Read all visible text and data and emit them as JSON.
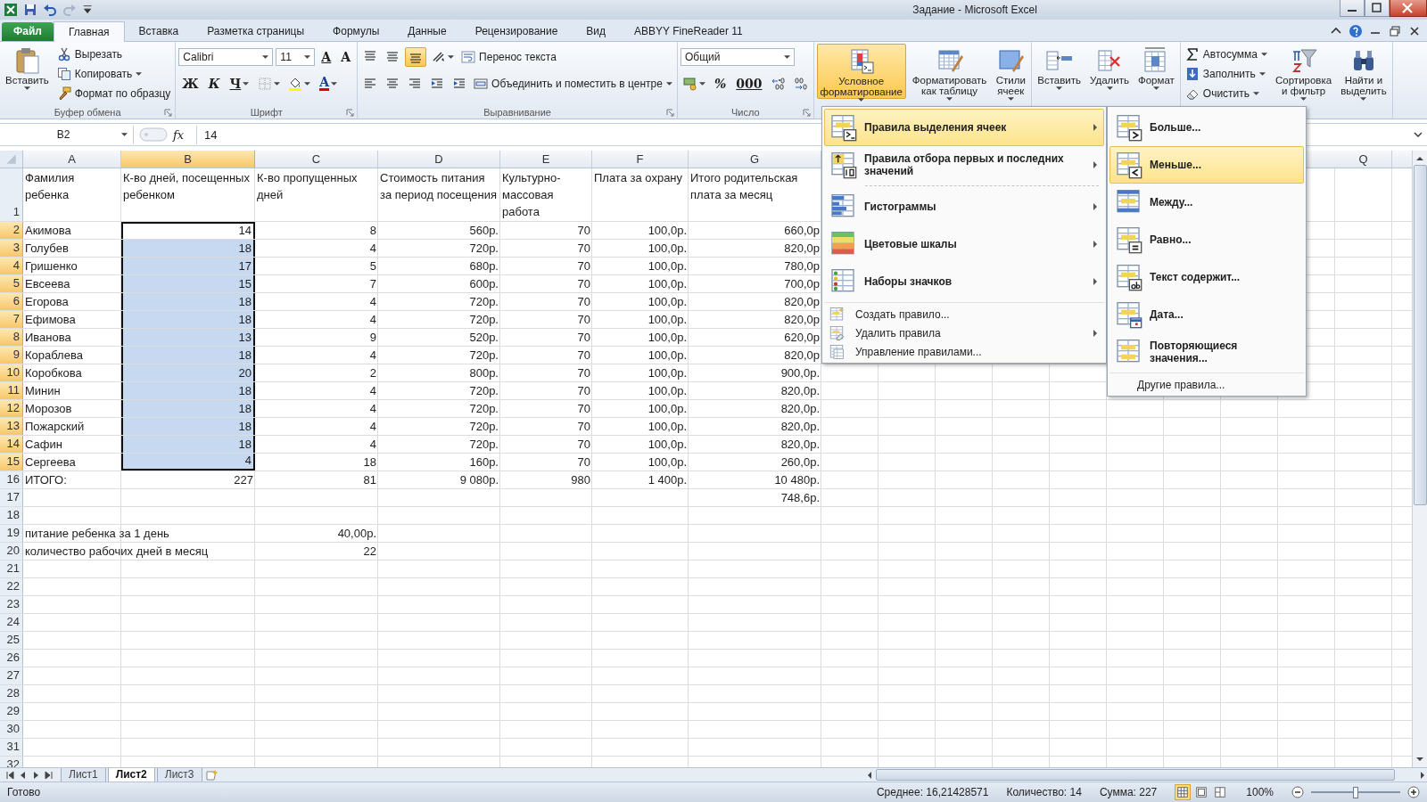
{
  "window": {
    "title": "Задание - Microsoft Excel"
  },
  "tabs": [
    {
      "label": "Файл",
      "kind": "file",
      "selected": false
    },
    {
      "label": "Главная",
      "kind": "tab",
      "selected": true
    },
    {
      "label": "Вставка",
      "kind": "tab",
      "selected": false
    },
    {
      "label": "Разметка страницы",
      "kind": "tab",
      "selected": false
    },
    {
      "label": "Формулы",
      "kind": "tab",
      "selected": false
    },
    {
      "label": "Данные",
      "kind": "tab",
      "selected": false
    },
    {
      "label": "Рецензирование",
      "kind": "tab",
      "selected": false
    },
    {
      "label": "Вид",
      "kind": "tab",
      "selected": false
    },
    {
      "label": "ABBYY FineReader 11",
      "kind": "tab",
      "selected": false
    }
  ],
  "ribbon": {
    "groups": [
      {
        "label": "Буфер обмена",
        "launcher": true,
        "content": [
          {
            "kind": "large",
            "label": "Вставить",
            "dropdown": true,
            "pressed": false
          },
          {
            "kind": "stack",
            "rows": [
              {
                "items": [
                  {
                    "kind": "small",
                    "label": "Вырезать",
                    "dropdown": false
                  }
                ]
              },
              {
                "items": [
                  {
                    "kind": "small",
                    "label": "Копировать",
                    "dropdown": true
                  }
                ]
              },
              {
                "items": [
                  {
                    "kind": "small",
                    "label": "Формат по образцу",
                    "dropdown": false
                  }
                ]
              }
            ]
          }
        ]
      },
      {
        "label": "Шрифт",
        "launcher": true,
        "content": [
          {
            "kind": "stack",
            "rows": [
              {
                "items": [
                  {
                    "kind": "field",
                    "value": "Calibri",
                    "dropdown": true
                  },
                  {
                    "kind": "field",
                    "value": "11",
                    "dropdown": true
                  },
                  {
                    "kind": "glyph",
                    "label": "A",
                    "dropdown": false
                  },
                  {
                    "kind": "glyph",
                    "label": "A",
                    "dropdown": false
                  }
                ]
              },
              {
                "items": [
                  {
                    "kind": "glyph",
                    "label": "Ж",
                    "dropdown": false
                  },
                  {
                    "kind": "glyph",
                    "label": "К",
                    "dropdown": false
                  },
                  {
                    "kind": "glyph",
                    "label": "Ч",
                    "dropdown": true
                  },
                  {
                    "kind": "tool",
                    "dropdown": true,
                    "pressed": false
                  },
                  {
                    "kind": "tool",
                    "dropdown": true,
                    "pressed": false
                  },
                  {
                    "kind": "color-glyph",
                    "label": "A",
                    "dropdown": true
                  }
                ]
              }
            ]
          }
        ]
      },
      {
        "label": "Выравнивание",
        "launcher": true,
        "content": [
          {
            "kind": "stack",
            "rows": [
              {
                "items": [
                  {
                    "kind": "tool",
                    "dropdown": false,
                    "pressed": false
                  },
                  {
                    "kind": "tool",
                    "dropdown": false,
                    "pressed": false
                  },
                  {
                    "kind": "tool",
                    "dropdown": false,
                    "pressed": true
                  },
                  {
                    "kind": "tool",
                    "dropdown": true,
                    "pressed": false
                  },
                  {
                    "kind": "small",
                    "label": "Перенос текста",
                    "dropdown": false
                  }
                ]
              },
              {
                "items": [
                  {
                    "kind": "tool",
                    "dropdown": false,
                    "pressed": false
                  },
                  {
                    "kind": "tool",
                    "dropdown": false,
                    "pressed": false
                  },
                  {
                    "kind": "tool",
                    "dropdown": false,
                    "pressed": false
                  },
                  {
                    "kind": "tool",
                    "dropdown": false,
                    "pressed": false
                  },
                  {
                    "kind": "tool",
                    "dropdown": false,
                    "pressed": false
                  },
                  {
                    "kind": "small",
                    "label": "Объединить и поместить в центре",
                    "dropdown": true
                  }
                ]
              }
            ]
          }
        ]
      },
      {
        "label": "Число",
        "launcher": true,
        "content": [
          {
            "kind": "stack",
            "rows": [
              {
                "items": [
                  {
                    "kind": "field",
                    "value": "Общий",
                    "dropdown": true
                  }
                ]
              },
              {
                "items": [
                  {
                    "kind": "tool",
                    "dropdown": true,
                    "pressed": false
                  },
                  {
                    "kind": "glyph",
                    "label": "%",
                    "dropdown": false
                  },
                  {
                    "kind": "glyph",
                    "label": "000",
                    "dropdown": false
                  },
                  {
                    "kind": "tool",
                    "dropdown": false,
                    "pressed": false
                  },
                  {
                    "kind": "tool",
                    "dropdown": false,
                    "pressed": false
                  }
                ]
              }
            ]
          }
        ]
      },
      {
        "content": [
          {
            "kind": "large",
            "label": "Условное\nформатирование",
            "dropdown": true,
            "pressed": true
          },
          {
            "kind": "large",
            "label": "Форматировать\nкак таблицу",
            "dropdown": true,
            "pressed": false
          },
          {
            "kind": "large",
            "label": "Стили\nячеек",
            "dropdown": true,
            "pressed": false
          }
        ]
      },
      {
        "content": [
          {
            "kind": "large",
            "label": "Вставить",
            "dropdown": true,
            "pressed": false
          },
          {
            "kind": "large",
            "label": "Удалить",
            "dropdown": true,
            "pressed": false
          },
          {
            "kind": "large",
            "label": "Формат",
            "dropdown": true,
            "pressed": false
          }
        ]
      },
      {
        "content": [
          {
            "kind": "stack",
            "rows": [
              {
                "items": [
                  {
                    "kind": "small",
                    "label": "Автосумма",
                    "dropdown": true
                  }
                ]
              },
              {
                "items": [
                  {
                    "kind": "small",
                    "label": "Заполнить",
                    "dropdown": true
                  }
                ]
              },
              {
                "items": [
                  {
                    "kind": "small",
                    "label": "Очистить",
                    "dropdown": true
                  }
                ]
              }
            ]
          },
          {
            "kind": "large",
            "label": "Сортировка\nи фильтр",
            "dropdown": true,
            "pressed": false
          },
          {
            "kind": "large",
            "label": "Найти и\nвыделить",
            "dropdown": true,
            "pressed": false
          }
        ]
      }
    ]
  },
  "formula_bar": {
    "name_box": "B2",
    "function_label": "fx",
    "value": "14"
  },
  "column_headers": [
    {
      "label": "A",
      "selected": false
    },
    {
      "label": "B",
      "selected": true
    },
    {
      "label": "C",
      "selected": false
    },
    {
      "label": "D",
      "selected": false
    },
    {
      "label": "E",
      "selected": false
    },
    {
      "label": "F",
      "selected": false
    },
    {
      "label": "G",
      "selected": false
    }
  ],
  "column_headers_right": [
    {
      "label": "Q",
      "selected": false
    }
  ],
  "rows": [
    {
      "number": "1",
      "selected": false,
      "cells": [
        {
          "text": "Фамилия ребенка",
          "kind": "wrap",
          "selected": false,
          "active": false
        },
        {
          "text": "К-во дней, посещенных ребенком",
          "kind": "wrap",
          "selected": false,
          "active": false
        },
        {
          "text": "К-во пропущенных дней",
          "kind": "wrap",
          "selected": false,
          "active": false
        },
        {
          "text": "Стоимость питания за период посещения",
          "kind": "wrap",
          "selected": false,
          "active": false
        },
        {
          "text": "Культурно-массовая работа",
          "kind": "wrap",
          "selected": false,
          "active": false
        },
        {
          "text": "Плата за охрану",
          "kind": "wrap",
          "selected": false,
          "active": false
        },
        {
          "text": "Итого родительская плата за месяц",
          "kind": "wrap",
          "selected": false,
          "active": false
        }
      ]
    },
    {
      "number": "2",
      "selected": true,
      "cells": [
        {
          "text": "Акимова",
          "kind": "text",
          "selected": false,
          "active": false
        },
        {
          "text": "14",
          "kind": "number",
          "selected": true,
          "active": true
        },
        {
          "text": "8",
          "kind": "number",
          "selected": false,
          "active": false
        },
        {
          "text": "560р.",
          "kind": "number",
          "selected": false,
          "active": false
        },
        {
          "text": "70",
          "kind": "number",
          "selected": false,
          "active": false
        },
        {
          "text": "100,0р.",
          "kind": "number",
          "selected": false,
          "active": false
        },
        {
          "text": "660,0р",
          "kind": "number",
          "selected": false,
          "active": false
        }
      ]
    },
    {
      "number": "3",
      "selected": true,
      "cells": [
        {
          "text": "Голубев",
          "kind": "text",
          "selected": false,
          "active": false
        },
        {
          "text": "18",
          "kind": "number",
          "selected": true,
          "active": false
        },
        {
          "text": "4",
          "kind": "number",
          "selected": false,
          "active": false
        },
        {
          "text": "720р.",
          "kind": "number",
          "selected": false,
          "active": false
        },
        {
          "text": "70",
          "kind": "number",
          "selected": false,
          "active": false
        },
        {
          "text": "100,0р.",
          "kind": "number",
          "selected": false,
          "active": false
        },
        {
          "text": "820,0р",
          "kind": "number",
          "selected": false,
          "active": false
        }
      ]
    },
    {
      "number": "4",
      "selected": true,
      "cells": [
        {
          "text": "Гришенко",
          "kind": "text",
          "selected": false,
          "active": false
        },
        {
          "text": "17",
          "kind": "number",
          "selected": true,
          "active": false
        },
        {
          "text": "5",
          "kind": "number",
          "selected": false,
          "active": false
        },
        {
          "text": "680р.",
          "kind": "number",
          "selected": false,
          "active": false
        },
        {
          "text": "70",
          "kind": "number",
          "selected": false,
          "active": false
        },
        {
          "text": "100,0р.",
          "kind": "number",
          "selected": false,
          "active": false
        },
        {
          "text": "780,0р",
          "kind": "number",
          "selected": false,
          "active": false
        }
      ]
    },
    {
      "number": "5",
      "selected": true,
      "cells": [
        {
          "text": "Евсеева",
          "kind": "text",
          "selected": false,
          "active": false
        },
        {
          "text": "15",
          "kind": "number",
          "selected": true,
          "active": false
        },
        {
          "text": "7",
          "kind": "number",
          "selected": false,
          "active": false
        },
        {
          "text": "600р.",
          "kind": "number",
          "selected": false,
          "active": false
        },
        {
          "text": "70",
          "kind": "number",
          "selected": false,
          "active": false
        },
        {
          "text": "100,0р.",
          "kind": "number",
          "selected": false,
          "active": false
        },
        {
          "text": "700,0р",
          "kind": "number",
          "selected": false,
          "active": false
        }
      ]
    },
    {
      "number": "6",
      "selected": true,
      "cells": [
        {
          "text": "Егорова",
          "kind": "text",
          "selected": false,
          "active": false
        },
        {
          "text": "18",
          "kind": "number",
          "selected": true,
          "active": false
        },
        {
          "text": "4",
          "kind": "number",
          "selected": false,
          "active": false
        },
        {
          "text": "720р.",
          "kind": "number",
          "selected": false,
          "active": false
        },
        {
          "text": "70",
          "kind": "number",
          "selected": false,
          "active": false
        },
        {
          "text": "100,0р.",
          "kind": "number",
          "selected": false,
          "active": false
        },
        {
          "text": "820,0р",
          "kind": "number",
          "selected": false,
          "active": false
        }
      ]
    },
    {
      "number": "7",
      "selected": true,
      "cells": [
        {
          "text": "Ефимова",
          "kind": "text",
          "selected": false,
          "active": false
        },
        {
          "text": "18",
          "kind": "number",
          "selected": true,
          "active": false
        },
        {
          "text": "4",
          "kind": "number",
          "selected": false,
          "active": false
        },
        {
          "text": "720р.",
          "kind": "number",
          "selected": false,
          "active": false
        },
        {
          "text": "70",
          "kind": "number",
          "selected": false,
          "active": false
        },
        {
          "text": "100,0р.",
          "kind": "number",
          "selected": false,
          "active": false
        },
        {
          "text": "820,0р",
          "kind": "number",
          "selected": false,
          "active": false
        }
      ]
    },
    {
      "number": "8",
      "selected": true,
      "cells": [
        {
          "text": "Иванова",
          "kind": "text",
          "selected": false,
          "active": false
        },
        {
          "text": "13",
          "kind": "number",
          "selected": true,
          "active": false
        },
        {
          "text": "9",
          "kind": "number",
          "selected": false,
          "active": false
        },
        {
          "text": "520р.",
          "kind": "number",
          "selected": false,
          "active": false
        },
        {
          "text": "70",
          "kind": "number",
          "selected": false,
          "active": false
        },
        {
          "text": "100,0р.",
          "kind": "number",
          "selected": false,
          "active": false
        },
        {
          "text": "620,0р",
          "kind": "number",
          "selected": false,
          "active": false
        }
      ]
    },
    {
      "number": "9",
      "selected": true,
      "cells": [
        {
          "text": "Кораблева",
          "kind": "text",
          "selected": false,
          "active": false
        },
        {
          "text": "18",
          "kind": "number",
          "selected": true,
          "active": false
        },
        {
          "text": "4",
          "kind": "number",
          "selected": false,
          "active": false
        },
        {
          "text": "720р.",
          "kind": "number",
          "selected": false,
          "active": false
        },
        {
          "text": "70",
          "kind": "number",
          "selected": false,
          "active": false
        },
        {
          "text": "100,0р.",
          "kind": "number",
          "selected": false,
          "active": false
        },
        {
          "text": "820,0р",
          "kind": "number",
          "selected": false,
          "active": false
        }
      ]
    },
    {
      "number": "10",
      "selected": true,
      "cells": [
        {
          "text": "Коробкова",
          "kind": "text",
          "selected": false,
          "active": false
        },
        {
          "text": "20",
          "kind": "number",
          "selected": true,
          "active": false
        },
        {
          "text": "2",
          "kind": "number",
          "selected": false,
          "active": false
        },
        {
          "text": "800р.",
          "kind": "number",
          "selected": false,
          "active": false
        },
        {
          "text": "70",
          "kind": "number",
          "selected": false,
          "active": false
        },
        {
          "text": "100,0р.",
          "kind": "number",
          "selected": false,
          "active": false
        },
        {
          "text": "900,0р.",
          "kind": "number",
          "selected": false,
          "active": false
        }
      ]
    },
    {
      "number": "11",
      "selected": true,
      "cells": [
        {
          "text": "Минин",
          "kind": "text",
          "selected": false,
          "active": false
        },
        {
          "text": "18",
          "kind": "number",
          "selected": true,
          "active": false
        },
        {
          "text": "4",
          "kind": "number",
          "selected": false,
          "active": false
        },
        {
          "text": "720р.",
          "kind": "number",
          "selected": false,
          "active": false
        },
        {
          "text": "70",
          "kind": "number",
          "selected": false,
          "active": false
        },
        {
          "text": "100,0р.",
          "kind": "number",
          "selected": false,
          "active": false
        },
        {
          "text": "820,0р.",
          "kind": "number",
          "selected": false,
          "active": false
        }
      ]
    },
    {
      "number": "12",
      "selected": true,
      "cells": [
        {
          "text": "Морозов",
          "kind": "text",
          "selected": false,
          "active": false
        },
        {
          "text": "18",
          "kind": "number",
          "selected": true,
          "active": false
        },
        {
          "text": "4",
          "kind": "number",
          "selected": false,
          "active": false
        },
        {
          "text": "720р.",
          "kind": "number",
          "selected": false,
          "active": false
        },
        {
          "text": "70",
          "kind": "number",
          "selected": false,
          "active": false
        },
        {
          "text": "100,0р.",
          "kind": "number",
          "selected": false,
          "active": false
        },
        {
          "text": "820,0р.",
          "kind": "number",
          "selected": false,
          "active": false
        }
      ]
    },
    {
      "number": "13",
      "selected": true,
      "cells": [
        {
          "text": "Пожарский",
          "kind": "text",
          "selected": false,
          "active": false
        },
        {
          "text": "18",
          "kind": "number",
          "selected": true,
          "active": false
        },
        {
          "text": "4",
          "kind": "number",
          "selected": false,
          "active": false
        },
        {
          "text": "720р.",
          "kind": "number",
          "selected": false,
          "active": false
        },
        {
          "text": "70",
          "kind": "number",
          "selected": false,
          "active": false
        },
        {
          "text": "100,0р.",
          "kind": "number",
          "selected": false,
          "active": false
        },
        {
          "text": "820,0р.",
          "kind": "number",
          "selected": false,
          "active": false
        }
      ]
    },
    {
      "number": "14",
      "selected": true,
      "cells": [
        {
          "text": "Сафин",
          "kind": "text",
          "selected": false,
          "active": false
        },
        {
          "text": "18",
          "kind": "number",
          "selected": true,
          "active": false
        },
        {
          "text": "4",
          "kind": "number",
          "selected": false,
          "active": false
        },
        {
          "text": "720р.",
          "kind": "number",
          "selected": false,
          "active": false
        },
        {
          "text": "70",
          "kind": "number",
          "selected": false,
          "active": false
        },
        {
          "text": "100,0р.",
          "kind": "number",
          "selected": false,
          "active": false
        },
        {
          "text": "820,0р.",
          "kind": "number",
          "selected": false,
          "active": false
        }
      ]
    },
    {
      "number": "15",
      "selected": true,
      "cells": [
        {
          "text": "Сергеева",
          "kind": "text",
          "selected": false,
          "active": false
        },
        {
          "text": "4",
          "kind": "number",
          "selected": true,
          "active": false
        },
        {
          "text": "18",
          "kind": "number",
          "selected": false,
          "active": false
        },
        {
          "text": "160р.",
          "kind": "number",
          "selected": false,
          "active": false
        },
        {
          "text": "70",
          "kind": "number",
          "selected": false,
          "active": false
        },
        {
          "text": "100,0р.",
          "kind": "number",
          "selected": false,
          "active": false
        },
        {
          "text": "260,0р.",
          "kind": "number",
          "selected": false,
          "active": false
        }
      ]
    },
    {
      "number": "16",
      "selected": false,
      "cells": [
        {
          "text": "ИТОГО:",
          "kind": "text",
          "selected": false,
          "active": false
        },
        {
          "text": "227",
          "kind": "number",
          "selected": false,
          "active": false
        },
        {
          "text": "81",
          "kind": "number",
          "selected": false,
          "active": false
        },
        {
          "text": "9 080р.",
          "kind": "number",
          "selected": false,
          "active": false
        },
        {
          "text": "980",
          "kind": "number",
          "selected": false,
          "active": false
        },
        {
          "text": "1 400р.",
          "kind": "number",
          "selected": false,
          "active": false
        },
        {
          "text": "10 480р.",
          "kind": "number",
          "selected": false,
          "active": false
        }
      ]
    },
    {
      "number": "17",
      "selected": false,
      "cells": [
        null,
        null,
        null,
        null,
        null,
        null,
        {
          "text": "748,6р.",
          "kind": "number",
          "selected": false,
          "active": false
        }
      ]
    },
    {
      "number": "18",
      "selected": false,
      "cells": []
    },
    {
      "number": "19",
      "selected": false,
      "cells": [
        {
          "text": "питание ребенка за 1 день",
          "kind": "text",
          "selected": false,
          "active": false
        },
        null,
        {
          "text": "40,00р.",
          "kind": "number",
          "selected": false,
          "active": false
        }
      ]
    },
    {
      "number": "20",
      "selected": false,
      "cells": [
        {
          "text": "количество рабочих дней в месяц",
          "kind": "text",
          "selected": false,
          "active": false
        },
        null,
        {
          "text": "22",
          "kind": "number",
          "selected": false,
          "active": false
        }
      ]
    },
    {
      "number": "21",
      "selected": false,
      "cells": []
    },
    {
      "number": "22",
      "selected": false,
      "cells": []
    },
    {
      "number": "23",
      "selected": false,
      "cells": []
    },
    {
      "number": "24",
      "selected": false,
      "cells": []
    },
    {
      "number": "25",
      "selected": false,
      "cells": []
    },
    {
      "number": "26",
      "selected": false,
      "cells": []
    },
    {
      "number": "27",
      "selected": false,
      "cells": []
    },
    {
      "number": "28",
      "selected": false,
      "cells": []
    },
    {
      "number": "29",
      "selected": false,
      "cells": []
    },
    {
      "number": "30",
      "selected": false,
      "cells": []
    },
    {
      "number": "31",
      "selected": false,
      "cells": []
    },
    {
      "number": "32",
      "selected": false,
      "cells": []
    }
  ],
  "conditional_formatting_menu": {
    "items": [
      {
        "kind": "large",
        "label": "Правила выделения ячеек",
        "submenu": true,
        "selected": true
      },
      {
        "kind": "large",
        "label": "Правила отбора первых и последних значений",
        "submenu": true,
        "selected": false
      },
      {
        "kind": "separator"
      },
      {
        "kind": "large",
        "label": "Гистограммы",
        "submenu": true,
        "selected": false
      },
      {
        "kind": "large",
        "label": "Цветовые шкалы",
        "submenu": true,
        "selected": false
      },
      {
        "kind": "large",
        "label": "Наборы значков",
        "submenu": true,
        "selected": false
      },
      {
        "kind": "small",
        "label": "Создать правило...",
        "submenu": false,
        "selected": false
      },
      {
        "kind": "small",
        "label": "Удалить правила",
        "submenu": true,
        "selected": false
      },
      {
        "kind": "small",
        "label": "Управление правилами...",
        "submenu": false,
        "selected": false
      }
    ]
  },
  "submenu": {
    "items": [
      {
        "kind": "large",
        "label": "Больше...",
        "selected": false
      },
      {
        "kind": "large",
        "label": "Меньше...",
        "selected": true
      },
      {
        "kind": "large",
        "label": "Между...",
        "selected": false
      },
      {
        "kind": "large",
        "label": "Равно...",
        "selected": false
      },
      {
        "kind": "large",
        "label": "Текст содержит...",
        "selected": false
      },
      {
        "kind": "large",
        "label": "Дата...",
        "selected": false
      },
      {
        "kind": "large",
        "label": "Повторяющиеся значения...",
        "selected": false
      },
      {
        "kind": "small",
        "label": "Другие правила...",
        "selected": false
      }
    ]
  },
  "sheets": [
    {
      "label": "Лист1",
      "selected": false
    },
    {
      "label": "Лист2",
      "selected": true
    },
    {
      "label": "Лист3",
      "selected": false
    }
  ],
  "status_bar": {
    "state": "Готово",
    "average": "Среднее: 16,21428571",
    "count": "Количество: 14",
    "sum": "Сумма: 227",
    "views": [
      {
        "selected": true
      },
      {
        "selected": false
      },
      {
        "selected": false
      }
    ],
    "zoom": {
      "reading": "100%",
      "level": 0.5
    }
  }
}
